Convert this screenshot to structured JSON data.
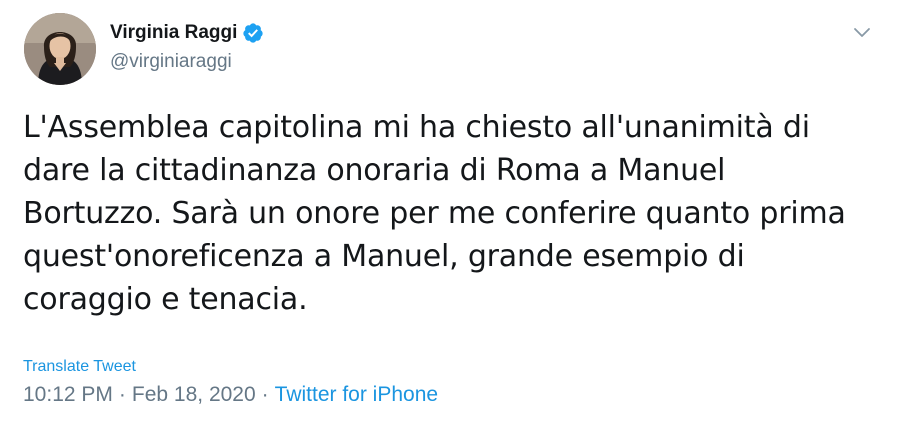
{
  "author": {
    "display_name": "Virginia Raggi",
    "handle": "@virginiaraggi",
    "verified": true,
    "avatar_icon": "profile-photo"
  },
  "tweet": {
    "text": "L'Assemblea capitolina mi ha chiesto all'unanimità di\ndare la cittadinanza onoraria di Roma a Manuel\nBortuzzo. Sarà un onore per me conferire quanto prima\nquest'onoreficenza a Manuel, grande esempio di\ncoraggio e tenacia.",
    "translate_label": "Translate Tweet",
    "time": "10:12 PM",
    "date": "Feb 18, 2020",
    "separator": "·",
    "source": "Twitter for iPhone"
  },
  "colors": {
    "link": "#1b95e0",
    "secondary_text": "#657786",
    "primary_text": "#14171a",
    "verified_badge": "#1da1f2"
  },
  "icons": {
    "menu": "chevron-down-icon",
    "verified": "verified-badge-icon"
  }
}
